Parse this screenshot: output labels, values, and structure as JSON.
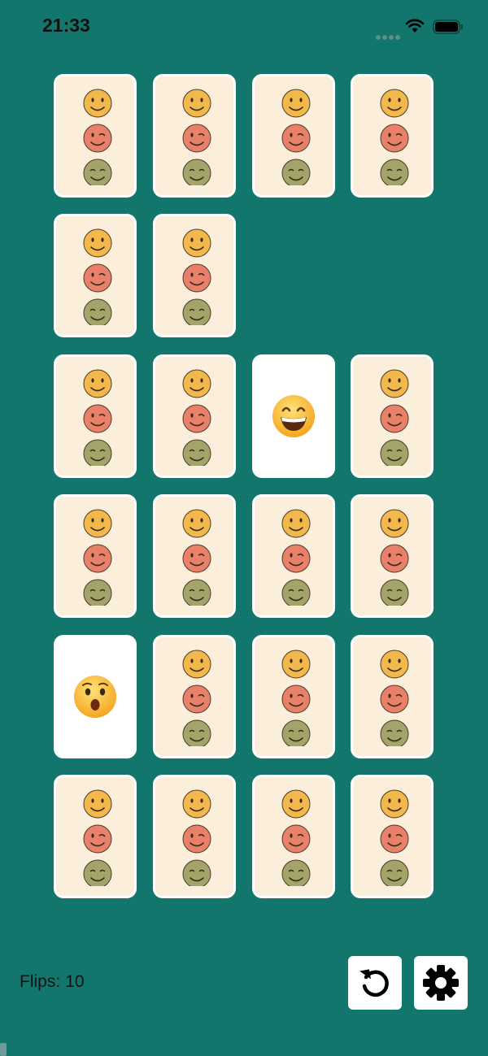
{
  "status_bar": {
    "time": "21:33"
  },
  "theme": {
    "background": "#12766C",
    "card_back": "#FBEEDB",
    "card_face": "#FFFFFF",
    "smiley_yellow": "#F2B84B",
    "smiley_red": "#E8806A",
    "smiley_olive": "#A3A46A"
  },
  "board": {
    "rows": [
      [
        "back",
        "back",
        "back",
        "back"
      ],
      [
        "back",
        "back",
        "empty",
        "empty"
      ],
      [
        "back",
        "back",
        "face-grin",
        "back"
      ],
      [
        "back",
        "back",
        "back",
        "back"
      ],
      [
        "face-astonished",
        "back",
        "back",
        "back"
      ],
      [
        "back",
        "back",
        "back",
        "back"
      ]
    ],
    "revealed": {
      "face-grin": "grinning-smiley-emoji",
      "face-astonished": "astonished-face-emoji"
    },
    "card_back_icons": [
      "smiley-icon",
      "wink-icon",
      "smile-closed-eyes-icon"
    ]
  },
  "footer": {
    "flips_label": "Flips:",
    "flips_count": "10",
    "restart_icon": "restart-icon",
    "settings_icon": "gear-icon"
  }
}
